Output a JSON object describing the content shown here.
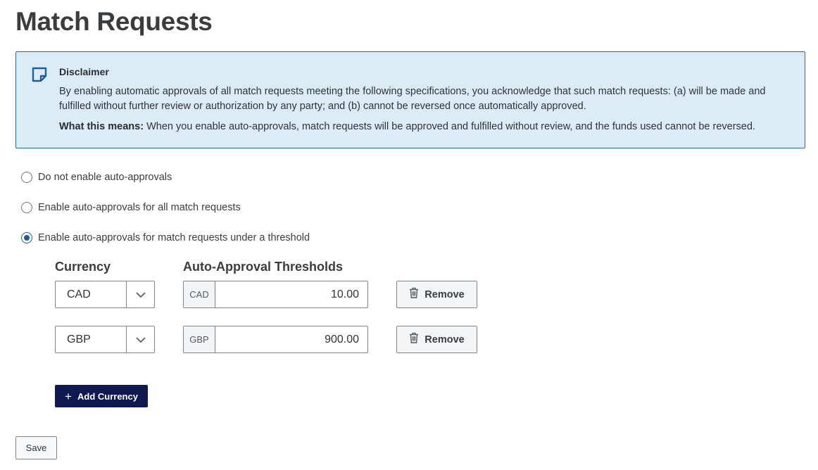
{
  "page": {
    "title": "Match Requests"
  },
  "disclaimer": {
    "icon": "note-icon",
    "title": "Disclaimer",
    "body": "By enabling automatic approvals of all match requests meeting the following specifications, you acknowledge that such match requests: (a) will be made and fulfilled without further review or authorization by any party; and (b) cannot be reversed once automatically approved.",
    "means_label": "What this means:",
    "means_text": " When you enable auto-approvals, match requests will be approved and fulfilled without review, and the funds used cannot be reversed."
  },
  "options": [
    {
      "label": "Do not enable auto-approvals",
      "checked": false
    },
    {
      "label": "Enable auto-approvals for all match requests",
      "checked": false
    },
    {
      "label": "Enable auto-approvals for match requests under a threshold",
      "checked": true
    }
  ],
  "thresholds": {
    "currency_header": "Currency",
    "threshold_header": "Auto-Approval Thresholds",
    "rows": [
      {
        "currency": "CAD",
        "prefix": "CAD",
        "amount": "10.00",
        "remove_label": "Remove"
      },
      {
        "currency": "GBP",
        "prefix": "GBP",
        "amount": "900.00",
        "remove_label": "Remove"
      }
    ],
    "add_label": "Add Currency"
  },
  "actions": {
    "save_label": "Save"
  },
  "colors": {
    "accent": "#1f5f95",
    "add_button": "#0f1a52",
    "disclaimer_bg": "#dcecf6",
    "disclaimer_border": "#2a6a96"
  }
}
